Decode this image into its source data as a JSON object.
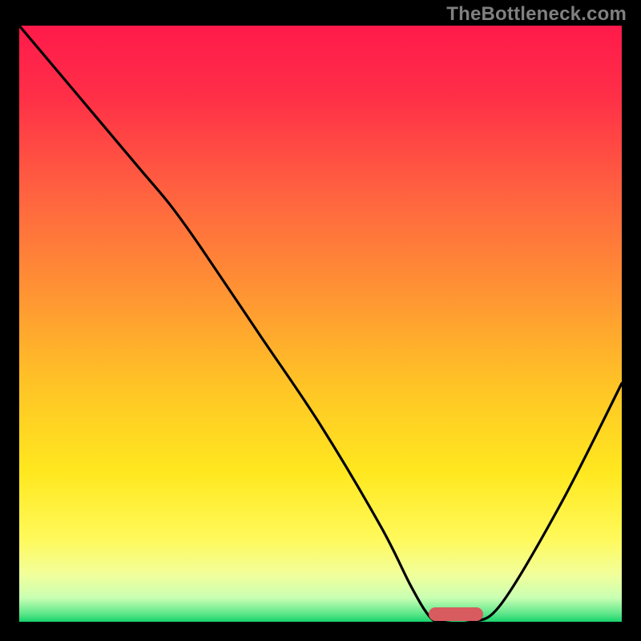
{
  "watermark": "TheBottleneck.com",
  "chart_data": {
    "type": "line",
    "title": "",
    "xlabel": "",
    "ylabel": "",
    "xlim": [
      0,
      100
    ],
    "ylim": [
      0,
      100
    ],
    "series": [
      {
        "name": "bottleneck-curve",
        "x": [
          0,
          10,
          20,
          25,
          30,
          40,
          50,
          60,
          65,
          68,
          70,
          75,
          80,
          90,
          100
        ],
        "y": [
          100,
          88,
          76,
          70,
          63,
          48,
          33,
          16,
          6,
          1,
          0,
          0,
          3,
          20,
          40
        ]
      }
    ],
    "optimal_range_x": [
      68,
      77
    ],
    "gradient_stops": [
      {
        "offset": 0.0,
        "color": "#ff1a4b"
      },
      {
        "offset": 0.12,
        "color": "#ff2f47"
      },
      {
        "offset": 0.28,
        "color": "#ff6240"
      },
      {
        "offset": 0.45,
        "color": "#ff9433"
      },
      {
        "offset": 0.6,
        "color": "#ffc326"
      },
      {
        "offset": 0.75,
        "color": "#ffe81f"
      },
      {
        "offset": 0.86,
        "color": "#fff95a"
      },
      {
        "offset": 0.92,
        "color": "#f2ff9a"
      },
      {
        "offset": 0.96,
        "color": "#c9ffb3"
      },
      {
        "offset": 0.985,
        "color": "#64e88d"
      },
      {
        "offset": 1.0,
        "color": "#17d36b"
      }
    ],
    "curve_color": "#000000",
    "marker_color": "#d85b60"
  }
}
